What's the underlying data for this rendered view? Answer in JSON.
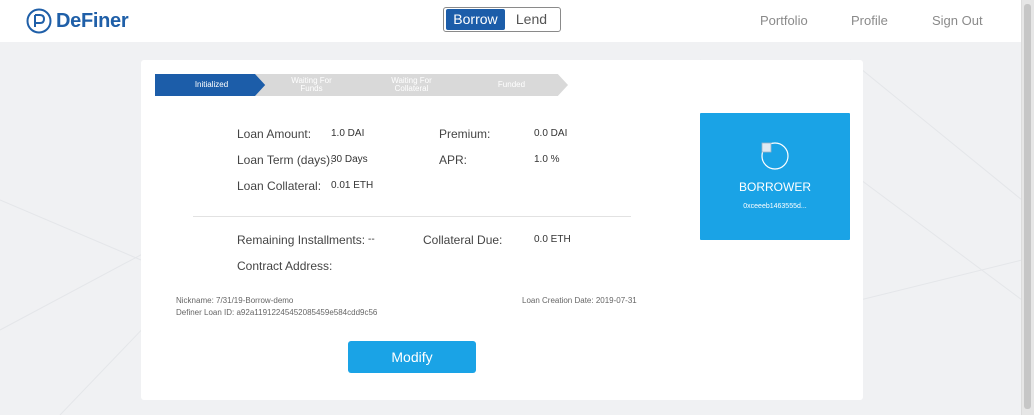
{
  "header": {
    "brand": "DeFiner",
    "toggle": {
      "borrow": "Borrow",
      "lend": "Lend",
      "selected": "Borrow"
    },
    "nav": [
      "Portfolio",
      "Profile",
      "Sign Out"
    ]
  },
  "progress": {
    "steps": [
      {
        "lines": [
          "Initialized"
        ],
        "active": true
      },
      {
        "lines": [
          "Waiting For",
          "Funds"
        ],
        "active": false
      },
      {
        "lines": [
          "Waiting For",
          "Collateral"
        ],
        "active": false
      },
      {
        "lines": [
          "Funded"
        ],
        "active": false
      }
    ]
  },
  "loan": {
    "amount_label": "Loan Amount:",
    "amount_value": "1.0 DAI",
    "term_label": "Loan Term (days):",
    "term_value": "30 Days",
    "collateral_label": "Loan Collateral:",
    "collateral_value": "0.01 ETH",
    "premium_label": "Premium:",
    "premium_value": "0.0 DAI",
    "apr_label": "APR:",
    "apr_value": "1.0 %",
    "installments_label": "Remaining Installments:",
    "installments_value": "--",
    "collateral_due_label": "Collateral Due:",
    "collateral_due_value": "0.0 ETH",
    "contract_label": "Contract Address:"
  },
  "meta": {
    "nickname": "Nickname: 7/31/19-Borrow-demo",
    "loan_id": "Definer Loan ID: a92a11912245452085459e584cdd9c56",
    "creation_date": "Loan Creation Date: 2019-07-31"
  },
  "actions": {
    "modify": "Modify"
  },
  "borrower": {
    "title": "BORROWER",
    "address": "0xceeeb1463555d..."
  },
  "colors": {
    "brand": "#1f5fa8",
    "active_step": "#1c5da9",
    "accent": "#1aa3e6"
  }
}
